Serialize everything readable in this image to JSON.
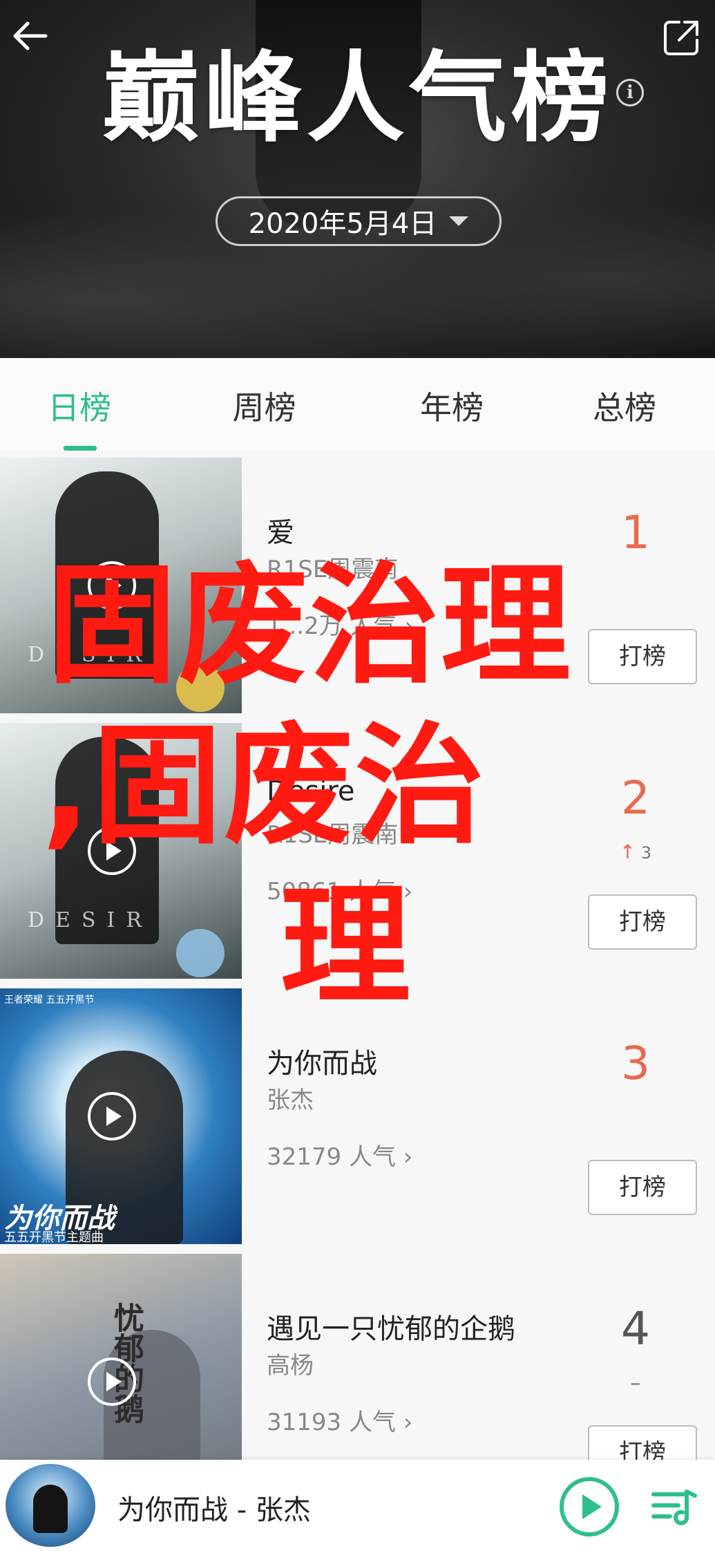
{
  "header": {
    "title": "巅峰人气榜",
    "date": "2020年5月4日",
    "icons": {
      "back": "back-arrow-icon",
      "share": "share-icon",
      "info": "info-icon"
    },
    "info_glyph": "i"
  },
  "tabs": [
    {
      "label": "日榜",
      "active": true
    },
    {
      "label": "周榜",
      "active": false
    },
    {
      "label": "年榜",
      "active": false
    },
    {
      "label": "总榜",
      "active": false
    }
  ],
  "songs": [
    {
      "title": "爱",
      "artist": "R1SE周震南",
      "popularity": "1...2万 人气",
      "rank": "1",
      "change": "",
      "vote": "打榜",
      "cover_brand": "DESIR"
    },
    {
      "title": "Desire",
      "artist": "R1SE周震南",
      "popularity": "50861 人气",
      "rank": "2",
      "change": "3",
      "vote": "打榜",
      "cover_brand": "DESIR"
    },
    {
      "title": "为你而战",
      "artist": "张杰",
      "popularity": "32179 人气",
      "rank": "3",
      "change": "",
      "vote": "打榜",
      "cover_text": "为你而战",
      "cover_sub": "五五开黑节主题曲",
      "cover_top": "王者荣耀 五五开黑节"
    },
    {
      "title": "遇见一只忧郁的企鹅",
      "artist": "高杨",
      "popularity": "31193 人气",
      "rank": "4",
      "change": "–",
      "vote": "打榜",
      "cover_text": "忧郁的鹅"
    }
  ],
  "watermark": {
    "line1": "固废治理",
    "line2": ",固废治",
    "line3": "理"
  },
  "player": {
    "now_playing": "为你而战 - 张杰"
  },
  "colors": {
    "accent": "#2fbf8a",
    "rank_top": "#e86a4e",
    "watermark": "#ff1a12"
  }
}
